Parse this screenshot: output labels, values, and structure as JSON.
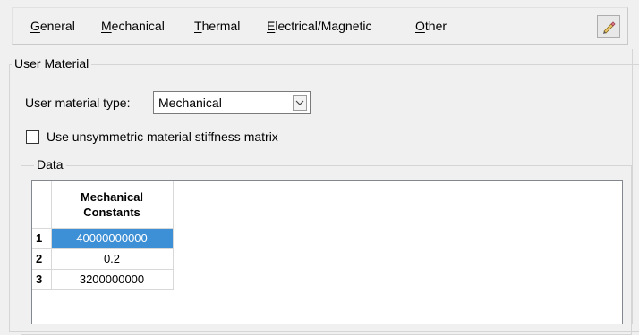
{
  "menubar": {
    "items": [
      {
        "label": "General"
      },
      {
        "label": "Mechanical"
      },
      {
        "label": "Thermal"
      },
      {
        "label": "Electrical/Magnetic"
      },
      {
        "label": "Other"
      }
    ],
    "edit_icon": "pencil-eraser-icon"
  },
  "user_material": {
    "group_label": "User Material",
    "type_label": "User material type:",
    "type_value": "Mechanical",
    "unsymmetric_label": "Use unsymmetric material stiffness matrix",
    "unsymmetric_checked": false
  },
  "data": {
    "group_label": "Data",
    "column_header_line1": "Mechanical",
    "column_header_line2": "Constants",
    "rows": [
      {
        "index": "1",
        "value": "40000000000",
        "selected": true
      },
      {
        "index": "2",
        "value": "0.2",
        "selected": false
      },
      {
        "index": "3",
        "value": "3200000000",
        "selected": false
      }
    ]
  },
  "colors": {
    "selection": "#3d8fd6",
    "background": "#f0f0f0"
  }
}
